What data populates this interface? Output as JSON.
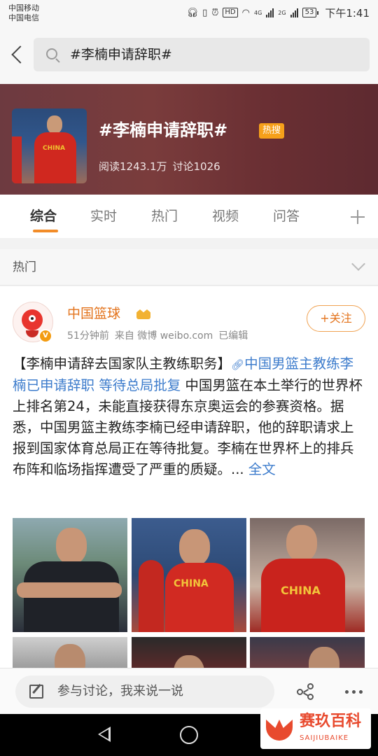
{
  "status_bar": {
    "carrier_1": "中国移动",
    "carrier_2": "中国电信",
    "network_1": "4G",
    "network_2": "2G",
    "battery": "53",
    "time": "下午1:41"
  },
  "search": {
    "query": "#李楠申请辞职#"
  },
  "topic": {
    "title": "#李楠申请辞职#",
    "badge": "热搜",
    "reads": "阅读1243.1万",
    "discussions": "讨论1026"
  },
  "tabs": [
    {
      "label": "综合",
      "active": true
    },
    {
      "label": "实时"
    },
    {
      "label": "热门"
    },
    {
      "label": "视频"
    },
    {
      "label": "问答"
    }
  ],
  "section": {
    "title": "热门"
  },
  "post": {
    "author": "中国篮球",
    "meta": {
      "time": "51分钟前",
      "source": "来自 微博 weibo.com",
      "edited": "已编辑"
    },
    "follow_label": "+关注",
    "title": "【李楠申请辞去国家队主教练职务】",
    "link_text": "中国男篮主教练李楠已申请辞职 等待总局批复",
    "body": " 中国男篮在本土举行的世界杯上排名第24，未能直接获得东京奥运会的参赛资格。据悉，中国男篮主教练李楠已经申请辞职，他的辞职请求上报到国家体育总局正在等待批复。李楠在世界杯上的排兵布阵和临场指挥遭受了严重的质疑。... ",
    "full_text_label": "全文"
  },
  "comment_bar": {
    "placeholder": "参与讨论，我来说一说"
  },
  "watermark": {
    "cn": "赛玖百科",
    "en": "SAIJIUBAIKE"
  },
  "colors": {
    "accent_orange": "#e3731c",
    "link_blue": "#3d7ccc",
    "badge_orange": "#f6a01a",
    "tab_underline": "#f28c28"
  }
}
